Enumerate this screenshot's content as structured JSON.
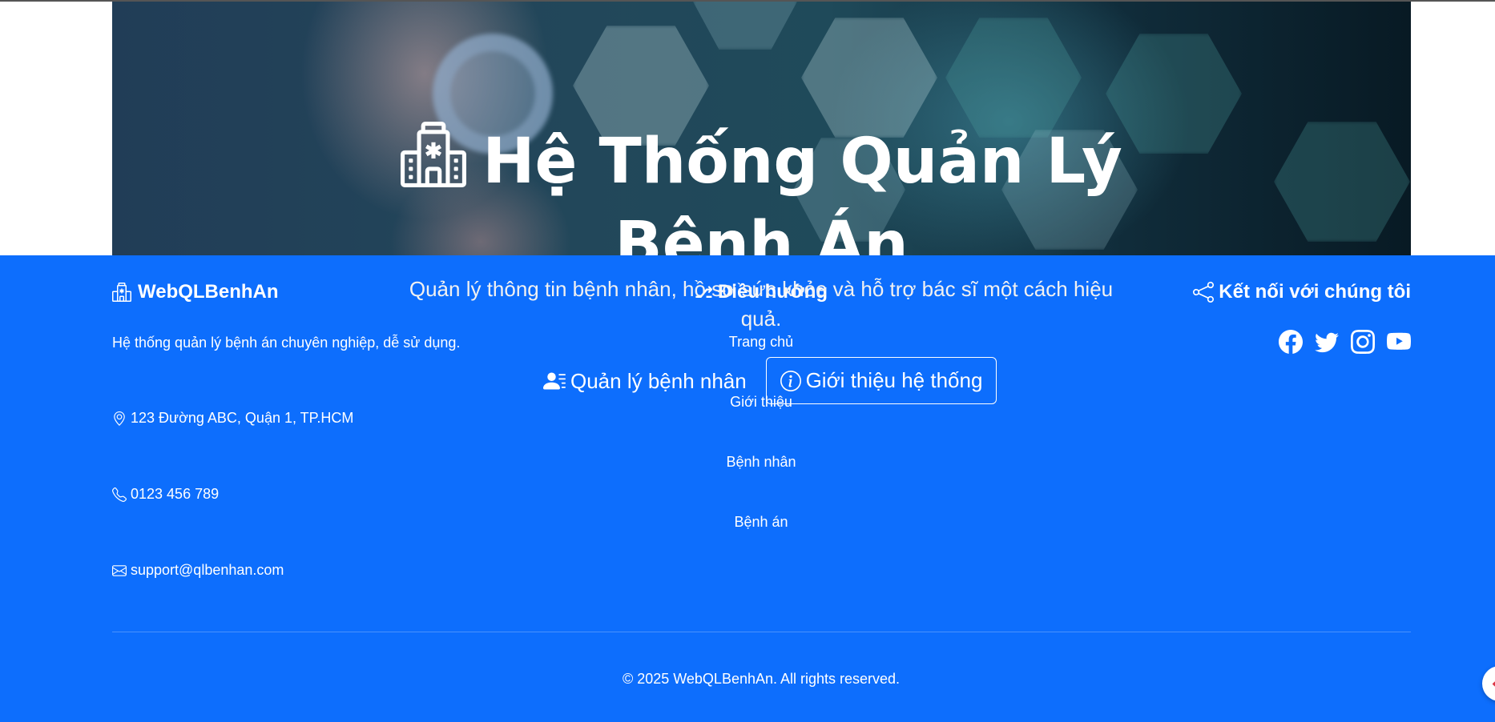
{
  "hero": {
    "title_line1": "Hệ Thống Quản Lý",
    "title_line2": "Bệnh Án",
    "subtitle_line1": "Quản lý thông tin bệnh nhân, hồ sơ sức khỏe và hỗ trợ bác sĩ một cách hiệu",
    "subtitle_line2": "quả.",
    "primary_button": "Quản lý bệnh nhân",
    "secondary_button": "Giới thiệu hệ thống",
    "title_icon": "hospital-icon"
  },
  "footer": {
    "brand": "WebQLBenhAn",
    "description": "Hệ thống quản lý bệnh án chuyên nghiệp, dễ sử dụng.",
    "address": "123 Đường ABC, Quận 1, TP.HCM",
    "phone": "0123 456 789",
    "email": "support@qlbenhan.com",
    "nav_heading": "Điều hướng",
    "nav_links": [
      "Trang chủ",
      "Giới thiệu",
      "Bệnh nhân",
      "Bệnh án"
    ],
    "social_heading": "Kết nối với chúng tôi",
    "socials": [
      "facebook-icon",
      "twitter-icon",
      "instagram-icon",
      "youtube-icon"
    ],
    "copyright": "© 2025 WebQLBenhAn. All rights reserved."
  },
  "colors": {
    "footer_bg": "#0d6efd",
    "text": "#ffffff",
    "hero_dark": "#0b2230"
  }
}
